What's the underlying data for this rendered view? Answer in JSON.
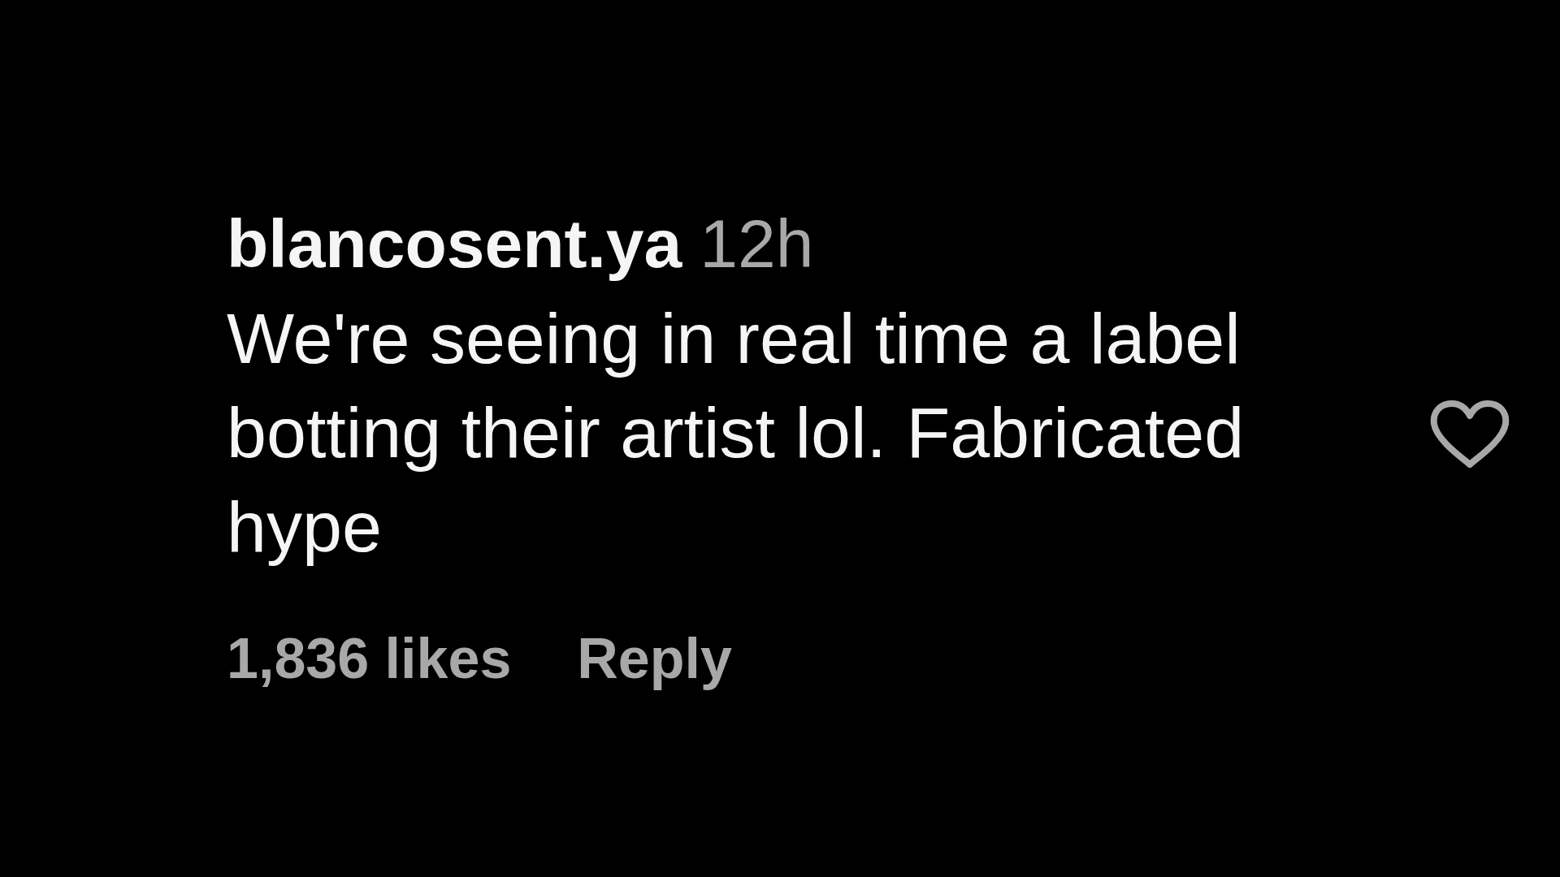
{
  "comment": {
    "username": "blancosent.ya",
    "time": "12h",
    "text": "We're seeing in real time a label botting their artist lol. Fabricated hype",
    "likes": "1,836 likes",
    "reply": "Reply",
    "liked": false
  }
}
